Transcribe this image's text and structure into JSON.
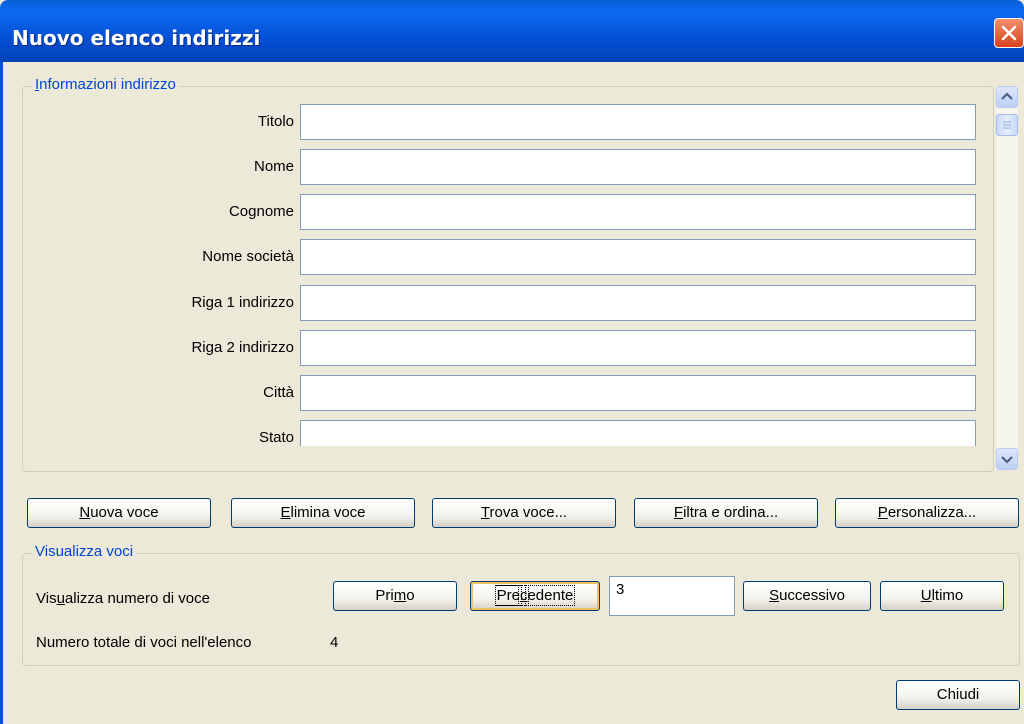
{
  "window": {
    "title": "Nuovo elenco indirizzi",
    "close_icon": "close-icon"
  },
  "address_info": {
    "group_label_first": "I",
    "group_label_rest": "nformazioni indirizzo",
    "fields": [
      {
        "label": "Titolo",
        "value": ""
      },
      {
        "label": "Nome",
        "value": ""
      },
      {
        "label": "Cognome",
        "value": ""
      },
      {
        "label": "Nome società",
        "value": ""
      },
      {
        "label": "Riga 1 indirizzo",
        "value": ""
      },
      {
        "label": "Riga 2 indirizzo",
        "value": ""
      },
      {
        "label": "Città",
        "value": ""
      },
      {
        "label": "Stato",
        "value": ""
      }
    ]
  },
  "entry_buttons": {
    "new_entry": {
      "underlined": "N",
      "rest": "uova voce"
    },
    "delete_entry": {
      "underlined": "E",
      "rest": "limina voce"
    },
    "find_entry": {
      "underlined": "T",
      "rest": "rova voce..."
    },
    "filter_sort": {
      "underlined": "F",
      "rest": "iltra e ordina..."
    },
    "customize": {
      "underlined": "P",
      "rest": "ersonalizza..."
    }
  },
  "view_entries": {
    "group_label": "Visualizza voci",
    "show_number_label_a": "Vis",
    "show_number_label_u": "u",
    "show_number_label_b": "alizza numero di voce",
    "first": {
      "a": "Pri",
      "u": "m",
      "b": "o"
    },
    "previous": {
      "a": "Pre",
      "u": "c",
      "b": "edente"
    },
    "current_number": "3",
    "next": {
      "a": "",
      "u": "S",
      "b": "uccessivo"
    },
    "last": {
      "a": "",
      "u": "U",
      "b": "ltimo"
    },
    "total_label": "Numero totale di voci nell'elenco",
    "total_value": "4"
  },
  "close_button": "Chiudi"
}
